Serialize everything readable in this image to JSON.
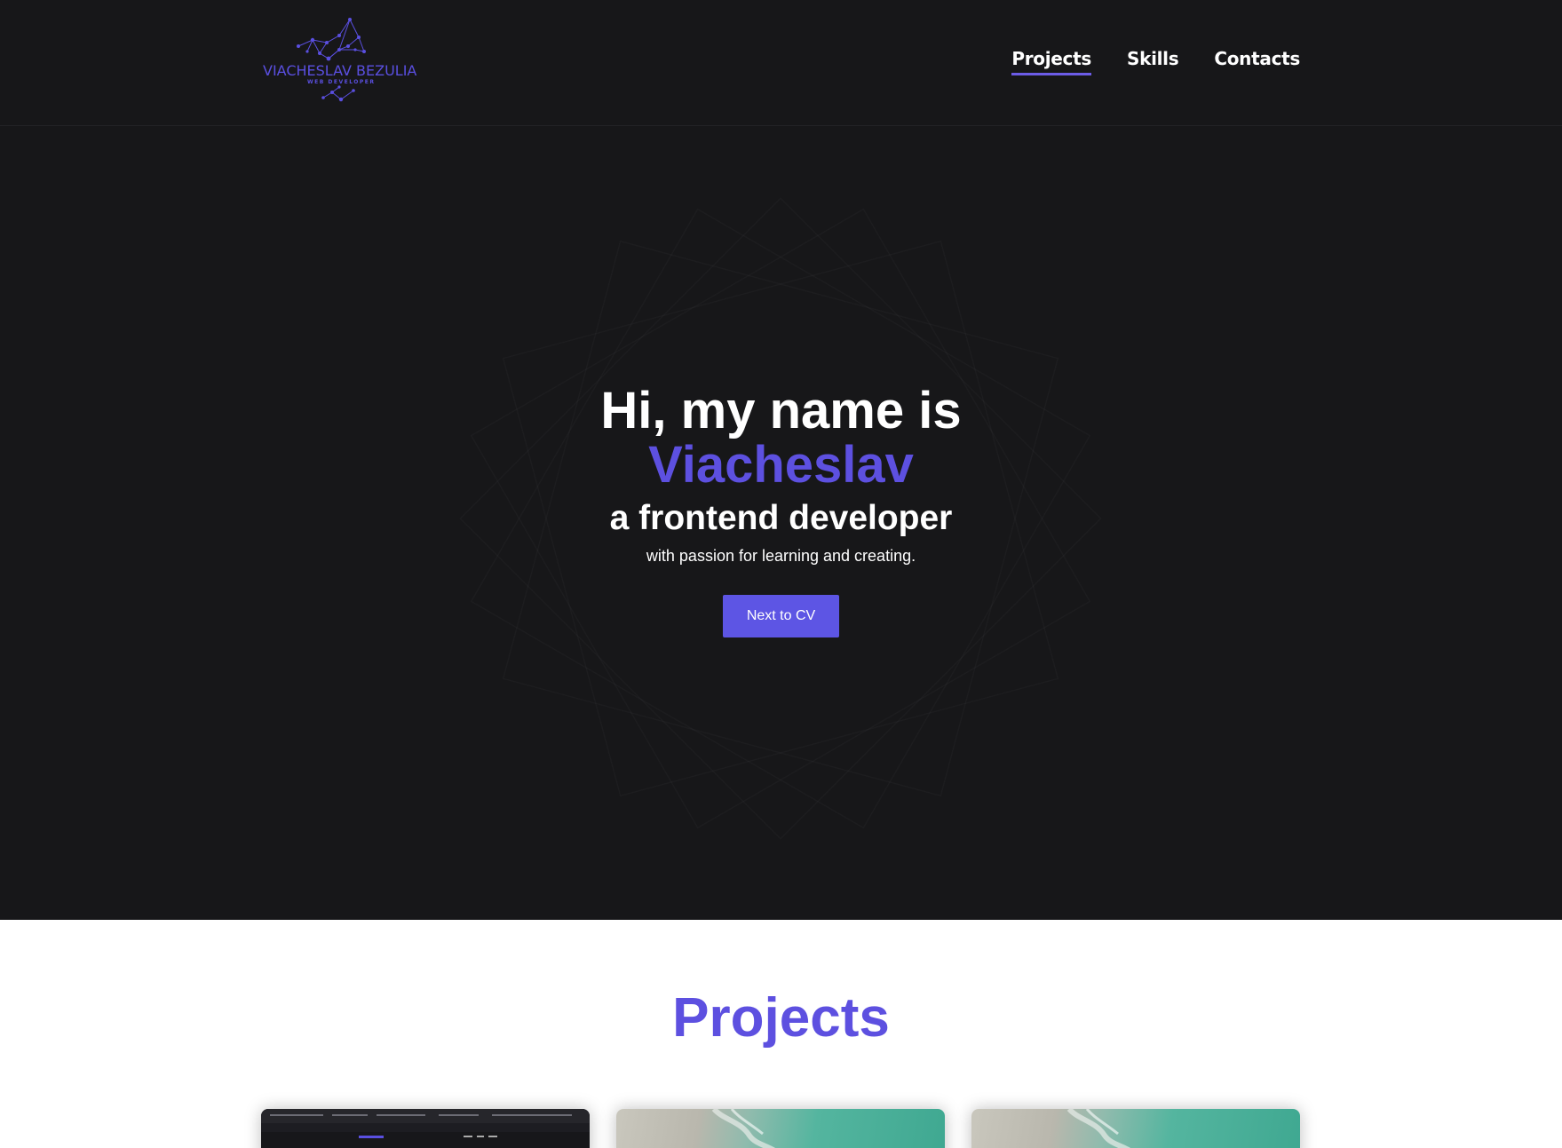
{
  "header": {
    "logo": {
      "name": "VIACHESLAV BEZULIA",
      "subtitle": "WEB DEVELOPER"
    },
    "nav": [
      {
        "label": "Projects",
        "active": true
      },
      {
        "label": "Skills",
        "active": false
      },
      {
        "label": "Contacts",
        "active": false
      }
    ]
  },
  "hero": {
    "greeting": "Hi, my name is",
    "name": "Viacheslav",
    "role": "a frontend developer",
    "tagline": "with passion for learning and creating.",
    "cta_label": "Next to CV"
  },
  "projects": {
    "title": "Projects",
    "cards": [
      {
        "thumbnail": "dark-website-screenshot"
      },
      {
        "thumbnail": "aerial-beach-photo"
      },
      {
        "thumbnail": "aerial-beach-photo"
      }
    ]
  },
  "colors": {
    "background_dark": "#171719",
    "accent": "#5d50e0",
    "button": "#5d55e4",
    "text_light": "#ffffff"
  }
}
